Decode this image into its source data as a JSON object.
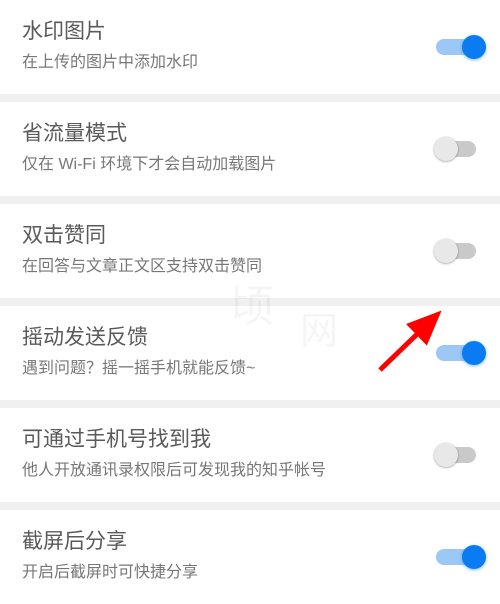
{
  "settings": [
    {
      "id": "watermark",
      "title": "水印图片",
      "desc": "在上传的图片中添加水印",
      "on": true
    },
    {
      "id": "data-saver",
      "title": "省流量模式",
      "desc": "仅在 Wi-Fi 环境下才会自动加载图片",
      "on": false
    },
    {
      "id": "double-tap",
      "title": "双击赞同",
      "desc": "在回答与文章正文区支持双击赞同",
      "on": false
    },
    {
      "id": "shake-feedback",
      "title": "摇动发送反馈",
      "desc": "遇到问题？摇一摇手机就能反馈~",
      "on": true
    },
    {
      "id": "find-by-phone",
      "title": "可通过手机号找到我",
      "desc": "他人开放通讯录权限后可发现我的知乎帐号",
      "on": false
    },
    {
      "id": "share-screenshot",
      "title": "截屏后分享",
      "desc": "开启后截屏时可快捷分享",
      "on": true
    }
  ],
  "annotation": {
    "target_index": 3
  },
  "colors": {
    "accent": "#0a7bf0",
    "track_on": "#9cc8f5",
    "track_off": "#c9c9c9"
  }
}
